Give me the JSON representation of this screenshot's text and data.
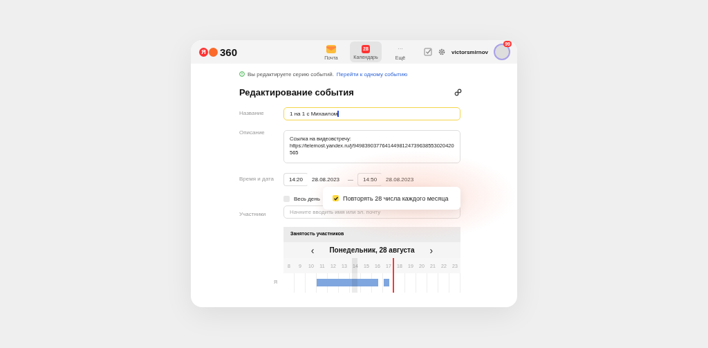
{
  "header": {
    "logo": {
      "ya": "Я",
      "text": "360"
    },
    "apps": [
      {
        "label": "Почта",
        "kind": "mail",
        "selected": false
      },
      {
        "label": "Календарь",
        "kind": "calendar",
        "badge": "28",
        "selected": true
      },
      {
        "label": "Ещё",
        "kind": "more",
        "icon": "···",
        "selected": false
      }
    ],
    "user": "victorsmirnov",
    "notifications": "99"
  },
  "notice": {
    "text": "Вы редактируете серию событий.",
    "link": "Перейти к одному событию"
  },
  "title": "Редактирование события",
  "fields": {
    "name_label": "Название",
    "name_value": "1 на 1 с Михаилом",
    "description_label": "Описание",
    "description_value": "Ссылка на видеовстречу:\nhttps://telemost.yandex.ru/j/94983903776414498124739638553020420\n565",
    "time_label": "Время и дата",
    "start_time": "14:20",
    "start_date": "28.08.2023",
    "dash": "—",
    "end_time": "14:50",
    "end_date": "28.08.2023",
    "all_day": {
      "label": "Весь день",
      "checked": false
    },
    "participants_label": "Участники",
    "participants_placeholder": "Начните вводить имя или эл. почту"
  },
  "repeat": {
    "label": "Повторять 28 числа каждого месяца",
    "checked": true
  },
  "busy": {
    "title": "Занятость участников",
    "prev": "‹",
    "date": "Понедельник, 28 августа",
    "next": "›",
    "hours": [
      "8",
      "9",
      "10",
      "11",
      "12",
      "13",
      "14",
      "15",
      "16",
      "17",
      "18",
      "19",
      "20",
      "21",
      "22",
      "23"
    ],
    "rows": [
      {
        "name": "Я"
      }
    ]
  }
}
